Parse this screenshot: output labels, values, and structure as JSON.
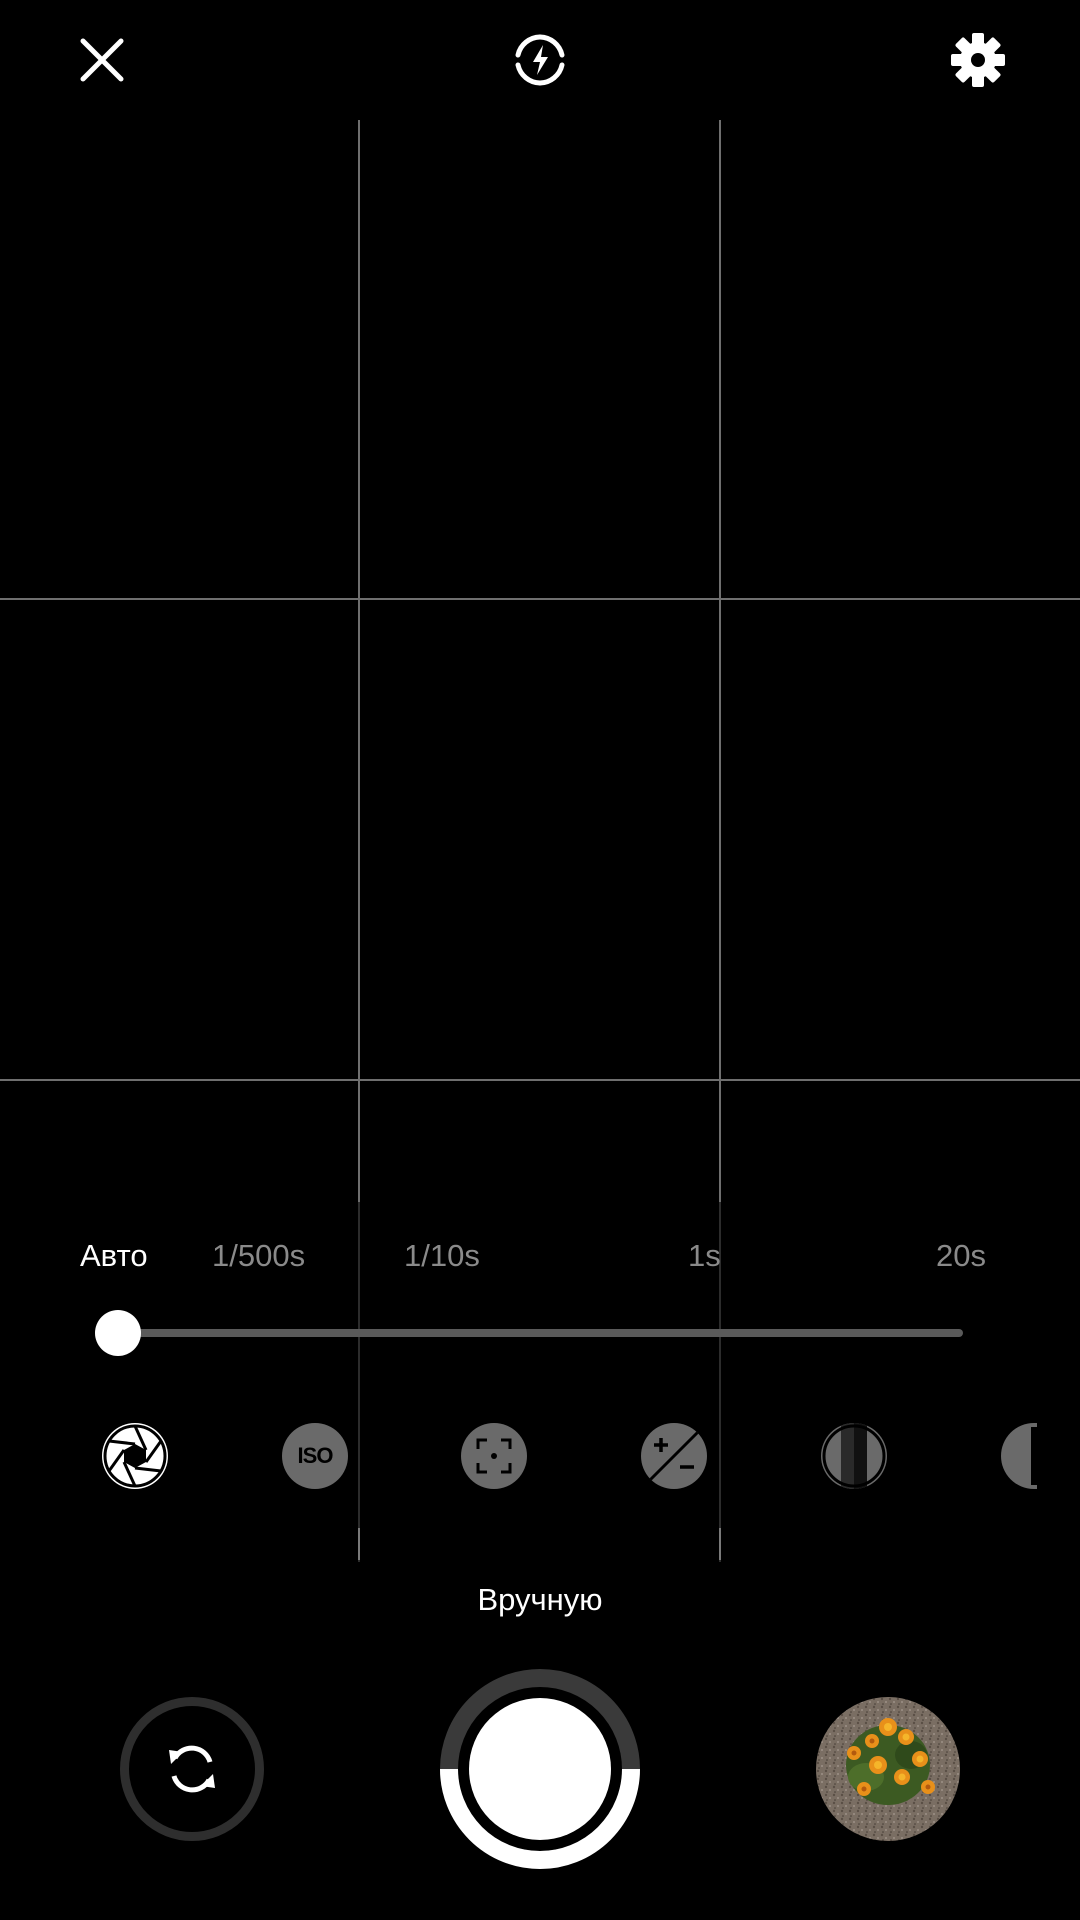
{
  "top_bar": {
    "close_icon": "close-icon",
    "flash_icon": "flash-auto-icon",
    "settings_icon": "gear-icon"
  },
  "shutter_speed": {
    "labels": [
      "Авто",
      "1/500s",
      "1/10s",
      "1s",
      "20s"
    ],
    "selected": "Авто",
    "slider_position_fraction": 0.0
  },
  "modes": [
    {
      "name": "aperture",
      "icon": "aperture-icon",
      "active": true
    },
    {
      "name": "iso",
      "icon": "iso-icon",
      "label": "ISO",
      "active": false
    },
    {
      "name": "focus",
      "icon": "focus-icon",
      "active": false
    },
    {
      "name": "exposure",
      "icon": "exposure-compensation-icon",
      "active": false
    },
    {
      "name": "white-balance",
      "icon": "white-balance-icon",
      "active": false
    },
    {
      "name": "more",
      "icon": "half-circle-icon",
      "active": false
    }
  ],
  "mode_label": "Вручную",
  "bottom": {
    "switch_camera_icon": "switch-camera-icon",
    "shutter_icon": "shutter-button",
    "gallery_thumbnail": "flowers-thumbnail"
  },
  "colors": {
    "background": "#000000",
    "active_text": "#ffffff",
    "inactive_text": "#8a8a8a",
    "grid_line": "#6f6f6f"
  }
}
